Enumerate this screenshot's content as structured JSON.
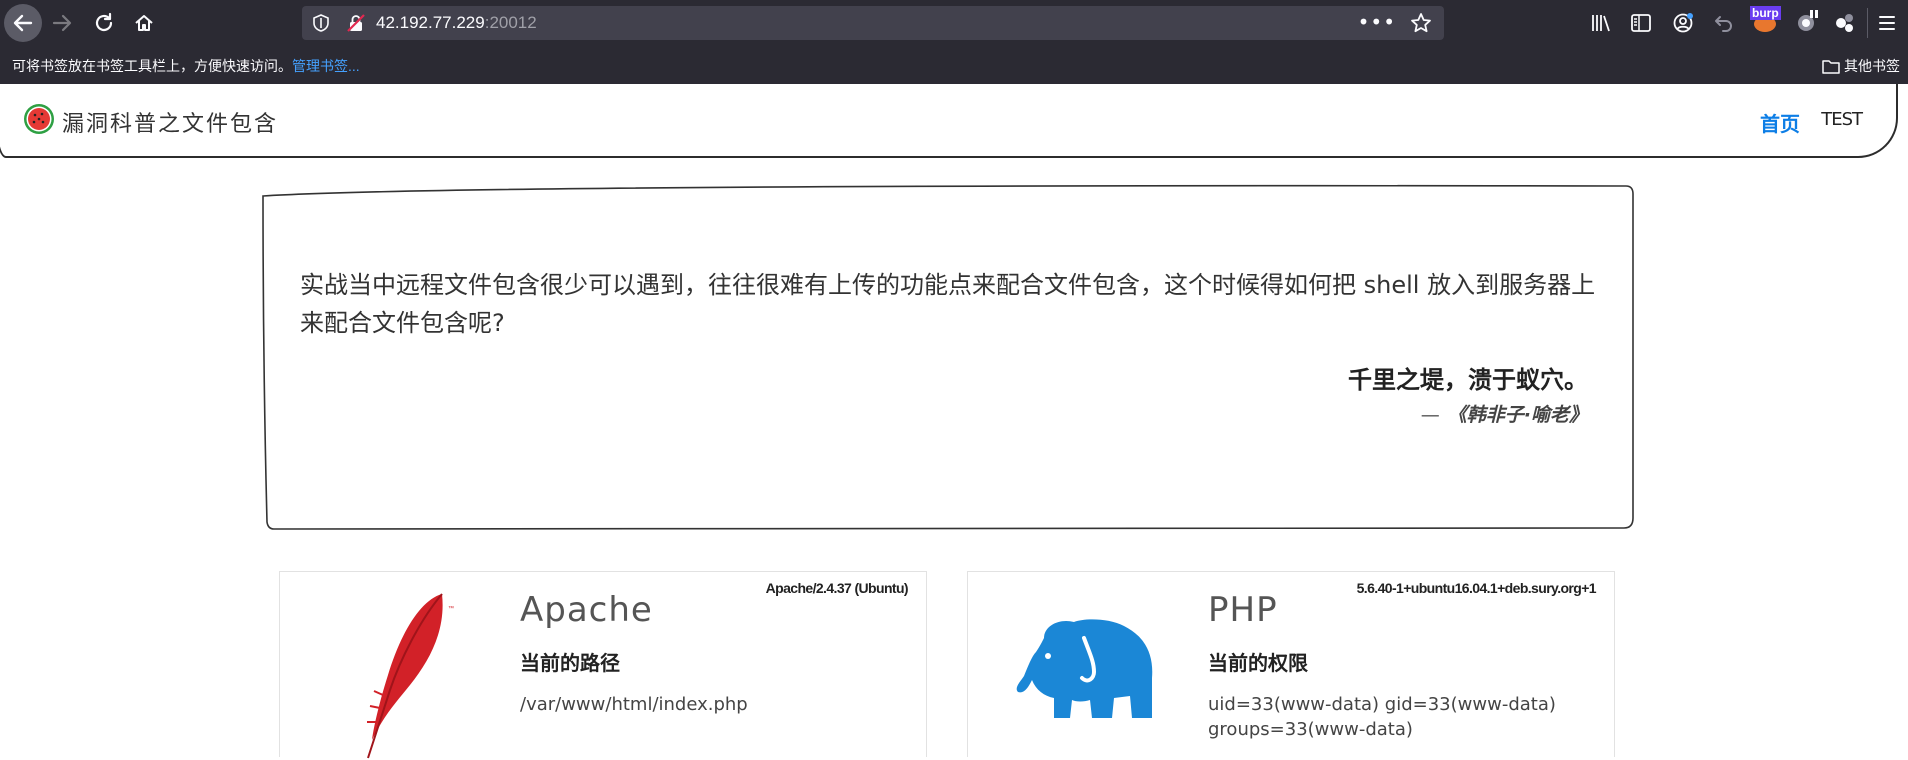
{
  "browser": {
    "url_host": "42.192.77.229",
    "url_port": ":20012",
    "bookmark_hint": "可将书签放在书签工具栏上，方便快速访问。",
    "bookmark_manage_link": "管理书签...",
    "other_bookmarks": "其他书签",
    "extension_badge": "burp"
  },
  "site": {
    "title": "漏洞科普之文件包含",
    "nav": {
      "home": "首页",
      "test": "TEST"
    },
    "accent_color": "#0d7ee6"
  },
  "quote": {
    "question": "实战当中远程文件包含很少可以遇到，往往很难有上传的功能点来配合文件包含，这个时候得如何把 shell 放入到服务器上来配合文件包含呢?",
    "main": "千里之堤，溃于蚁穴。",
    "dash": "—",
    "source": "《韩非子·喻老》"
  },
  "cards": {
    "apache": {
      "version": "Apache/2.4.37 (Ubuntu)",
      "title": "Apache",
      "label": "当前的路径",
      "value": "/var/www/html/index.php",
      "icon": "apache-feather-icon",
      "icon_color": "#d22128"
    },
    "php": {
      "version": "5.6.40-1+ubuntu16.04.1+deb.sury.org+1",
      "title": "PHP",
      "label": "当前的权限",
      "value": "uid=33(www-data) gid=33(www-data) groups=33(www-data)",
      "icon": "php-elephant-icon",
      "icon_color": "#1b87d6"
    }
  }
}
